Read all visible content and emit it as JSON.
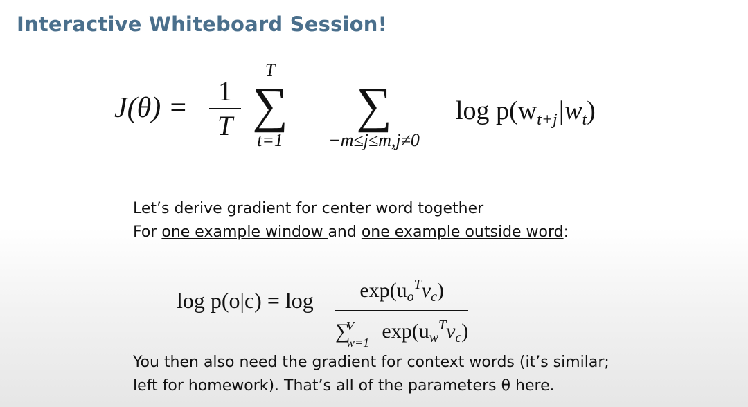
{
  "slide": {
    "title": "Interactive Whiteboard Session!",
    "objective": {
      "lhs": "J(θ) =",
      "frac_num": "1",
      "frac_den": "T",
      "sum1_upper": "T",
      "sum1_lower": "t=1",
      "sum2_lower": "−m≤j≤m,j≠0",
      "term_prefix": "log p(w",
      "term_sub1": "t+j",
      "term_mid": "|w",
      "term_sub2": "t",
      "term_suffix": ")"
    },
    "line1": "Let’s derive gradient for center word together",
    "line2_prefix": "For ",
    "line2_u1": "one example window ",
    "line2_mid": "and ",
    "line2_u2": "one example outside word",
    "line2_suffix": ":",
    "softmax": {
      "lhs": "log p(o|c) = log",
      "num_a": "exp(u",
      "num_sub": "o",
      "num_sup": "T",
      "num_b": "v",
      "num_sub2": "c",
      "num_c": ")",
      "den_sum_upper": "V",
      "den_sum_lower": "w=1",
      "den_a": "exp(u",
      "den_sub": "w",
      "den_sup": "T",
      "den_b": "v",
      "den_sub2": "c",
      "den_c": ")"
    },
    "line3": "You then also need the gradient for context words (it’s similar;",
    "line4": "left for homework). That’s all of the parameters θ here."
  }
}
